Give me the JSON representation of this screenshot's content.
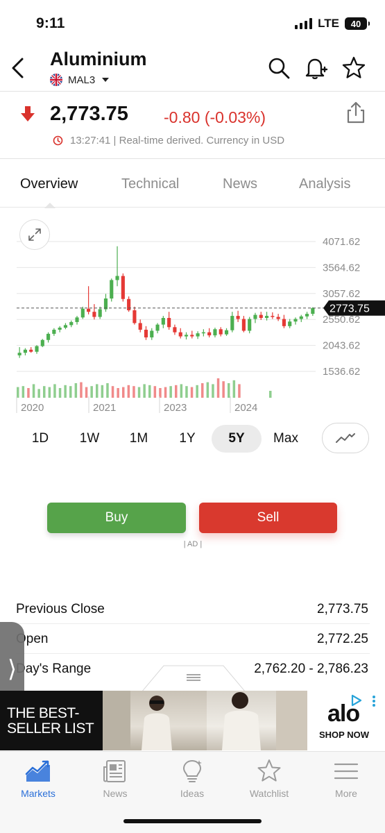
{
  "status_bar": {
    "time": "9:11",
    "network": "LTE",
    "battery": "40"
  },
  "header": {
    "title": "Aluminium",
    "symbol": "MAL3",
    "icons": [
      "back-icon",
      "search-icon",
      "bell-plus-icon",
      "star-icon"
    ]
  },
  "quote": {
    "price": "2,773.75",
    "change": "-0.80 (-0.03%)",
    "direction": "down",
    "meta": "13:27:41 | Real-time derived. Currency in USD",
    "down_color": "#d9322c"
  },
  "tabs": [
    {
      "label": "Overview",
      "active": true
    },
    {
      "label": "Technical",
      "active": false
    },
    {
      "label": "News",
      "active": false
    },
    {
      "label": "Analysis",
      "active": false
    }
  ],
  "chart_data": {
    "type": "candlestick",
    "y_ticks": [
      "4071.62",
      "3564.62",
      "3057.62",
      "2550.62",
      "2043.62",
      "1536.62"
    ],
    "ylim": [
      1536.62,
      4071.62
    ],
    "x_labels": [
      "2020",
      "2021",
      "2023",
      "2024"
    ],
    "current_price_label": "2773.75",
    "current_price": 2773.75,
    "grid": true,
    "up_color": "#4caf50",
    "down_color": "#e53935",
    "candles": [
      {
        "o": 1850,
        "h": 2010,
        "l": 1800,
        "c": 1900
      },
      {
        "o": 1900,
        "h": 1990,
        "l": 1850,
        "c": 1960
      },
      {
        "o": 1960,
        "h": 2010,
        "l": 1900,
        "c": 1920
      },
      {
        "o": 1920,
        "h": 2050,
        "l": 1880,
        "c": 2030
      },
      {
        "o": 2030,
        "h": 2170,
        "l": 2010,
        "c": 2150
      },
      {
        "o": 2150,
        "h": 2300,
        "l": 2100,
        "c": 2270
      },
      {
        "o": 2270,
        "h": 2380,
        "l": 2230,
        "c": 2350
      },
      {
        "o": 2350,
        "h": 2420,
        "l": 2300,
        "c": 2390
      },
      {
        "o": 2390,
        "h": 2480,
        "l": 2360,
        "c": 2440
      },
      {
        "o": 2440,
        "h": 2530,
        "l": 2400,
        "c": 2500
      },
      {
        "o": 2500,
        "h": 2620,
        "l": 2450,
        "c": 2590
      },
      {
        "o": 2590,
        "h": 2800,
        "l": 2560,
        "c": 2760
      },
      {
        "o": 2760,
        "h": 3200,
        "l": 2650,
        "c": 2700
      },
      {
        "o": 2700,
        "h": 2850,
        "l": 2550,
        "c": 2600
      },
      {
        "o": 2600,
        "h": 2800,
        "l": 2560,
        "c": 2750
      },
      {
        "o": 2750,
        "h": 3050,
        "l": 2700,
        "c": 2960
      },
      {
        "o": 2960,
        "h": 3350,
        "l": 2900,
        "c": 3320
      },
      {
        "o": 3320,
        "h": 3980,
        "l": 3200,
        "c": 3400
      },
      {
        "o": 3400,
        "h": 3450,
        "l": 2900,
        "c": 2950
      },
      {
        "o": 2950,
        "h": 3000,
        "l": 2700,
        "c": 2730
      },
      {
        "o": 2730,
        "h": 2800,
        "l": 2450,
        "c": 2480
      },
      {
        "o": 2480,
        "h": 2550,
        "l": 2300,
        "c": 2350
      },
      {
        "o": 2350,
        "h": 2420,
        "l": 2150,
        "c": 2200
      },
      {
        "o": 2200,
        "h": 2380,
        "l": 2150,
        "c": 2330
      },
      {
        "o": 2330,
        "h": 2480,
        "l": 2280,
        "c": 2450
      },
      {
        "o": 2450,
        "h": 2620,
        "l": 2380,
        "c": 2580
      },
      {
        "o": 2580,
        "h": 2700,
        "l": 2350,
        "c": 2400
      },
      {
        "o": 2400,
        "h": 2450,
        "l": 2250,
        "c": 2300
      },
      {
        "o": 2300,
        "h": 2380,
        "l": 2180,
        "c": 2220
      },
      {
        "o": 2220,
        "h": 2300,
        "l": 2160,
        "c": 2250
      },
      {
        "o": 2250,
        "h": 2330,
        "l": 2180,
        "c": 2220
      },
      {
        "o": 2220,
        "h": 2320,
        "l": 2170,
        "c": 2280
      },
      {
        "o": 2280,
        "h": 2360,
        "l": 2220,
        "c": 2300
      },
      {
        "o": 2300,
        "h": 2380,
        "l": 2200,
        "c": 2240
      },
      {
        "o": 2240,
        "h": 2390,
        "l": 2200,
        "c": 2360
      },
      {
        "o": 2360,
        "h": 2400,
        "l": 2220,
        "c": 2260
      },
      {
        "o": 2260,
        "h": 2380,
        "l": 2230,
        "c": 2340
      },
      {
        "o": 2340,
        "h": 2700,
        "l": 2300,
        "c": 2620
      },
      {
        "o": 2620,
        "h": 2720,
        "l": 2500,
        "c": 2560
      },
      {
        "o": 2560,
        "h": 2620,
        "l": 2300,
        "c": 2330
      },
      {
        "o": 2330,
        "h": 2600,
        "l": 2280,
        "c": 2560
      },
      {
        "o": 2560,
        "h": 2680,
        "l": 2480,
        "c": 2640
      },
      {
        "o": 2640,
        "h": 2700,
        "l": 2540,
        "c": 2580
      },
      {
        "o": 2580,
        "h": 2700,
        "l": 2530,
        "c": 2620
      },
      {
        "o": 2620,
        "h": 2690,
        "l": 2560,
        "c": 2600
      },
      {
        "o": 2600,
        "h": 2660,
        "l": 2520,
        "c": 2560
      },
      {
        "o": 2560,
        "h": 2640,
        "l": 2380,
        "c": 2420
      },
      {
        "o": 2420,
        "h": 2560,
        "l": 2380,
        "c": 2510
      },
      {
        "o": 2510,
        "h": 2590,
        "l": 2450,
        "c": 2560
      },
      {
        "o": 2560,
        "h": 2640,
        "l": 2500,
        "c": 2610
      },
      {
        "o": 2610,
        "h": 2700,
        "l": 2560,
        "c": 2660
      },
      {
        "o": 2660,
        "h": 2790,
        "l": 2620,
        "c": 2773.75
      }
    ],
    "volume": [
      0.55,
      0.6,
      0.5,
      0.7,
      0.45,
      0.6,
      0.55,
      0.7,
      0.5,
      0.65,
      0.6,
      0.75,
      0.8,
      0.55,
      0.6,
      0.7,
      0.65,
      0.75,
      0.6,
      0.5,
      0.55,
      0.65,
      0.6,
      0.55,
      0.7,
      0.65,
      0.6,
      0.5,
      0.55,
      0.6,
      0.65,
      0.7,
      0.6,
      0.55,
      0.65,
      0.75,
      0.8,
      0.7,
      1.0,
      0.85,
      0.75,
      0.9,
      0.7
    ]
  },
  "ranges": [
    {
      "label": "1D",
      "active": false
    },
    {
      "label": "1W",
      "active": false
    },
    {
      "label": "1M",
      "active": false
    },
    {
      "label": "1Y",
      "active": false
    },
    {
      "label": "5Y",
      "active": true
    },
    {
      "label": "Max",
      "active": false
    }
  ],
  "actions": {
    "buy": "Buy",
    "sell": "Sell",
    "ad_label": "| AD |"
  },
  "stats": [
    {
      "label": "Previous Close",
      "value": "2,773.75"
    },
    {
      "label": "Open",
      "value": "2,772.25"
    },
    {
      "label": "Day's Range",
      "value": "2,762.20 - 2,786.23"
    }
  ],
  "ad_banner": {
    "headline": "THE BEST-SELLER LIST",
    "brand": "alo",
    "cta": "SHOP NOW"
  },
  "bottom_nav": [
    {
      "label": "Markets",
      "icon": "markets-chart-icon",
      "active": true
    },
    {
      "label": "News",
      "icon": "newspaper-icon",
      "active": false
    },
    {
      "label": "Ideas",
      "icon": "lightbulb-icon",
      "active": false
    },
    {
      "label": "Watchlist",
      "icon": "star-icon",
      "active": false
    },
    {
      "label": "More",
      "icon": "menu-icon",
      "active": false
    }
  ],
  "colors": {
    "accent_blue": "#2a6fd8",
    "buy_green": "#56a34a",
    "sell_red": "#d9392e",
    "down_red": "#d9322c"
  }
}
